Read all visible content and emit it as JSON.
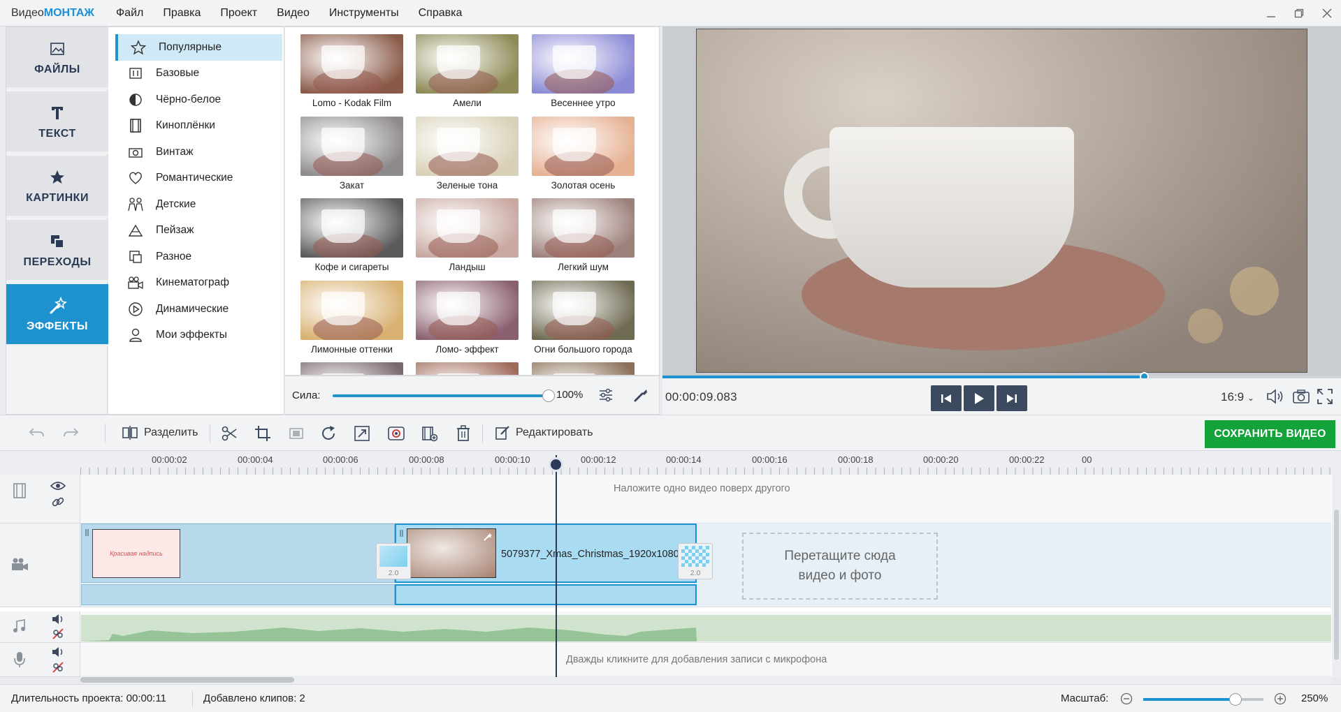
{
  "app": {
    "title_prefix": "Видео",
    "title_brand": "МОНТАЖ"
  },
  "menu": [
    "Файл",
    "Правка",
    "Проект",
    "Видео",
    "Инструменты",
    "Справка"
  ],
  "left_tabs": [
    {
      "label": "ФАЙЛЫ",
      "icon": "image-icon"
    },
    {
      "label": "ТЕКСТ",
      "icon": "text-icon"
    },
    {
      "label": "КАРТИНКИ",
      "icon": "star-icon"
    },
    {
      "label": "ПЕРЕХОДЫ",
      "icon": "transitions-icon"
    },
    {
      "label": "ЭФФЕКТЫ",
      "icon": "wand-icon",
      "active": true
    }
  ],
  "categories": [
    {
      "label": "Популярные",
      "icon": "star-outline-icon",
      "selected": true
    },
    {
      "label": "Базовые",
      "icon": "sliders-icon"
    },
    {
      "label": "Чёрно-белое",
      "icon": "half-circle-icon"
    },
    {
      "label": "Киноплёнки",
      "icon": "filmstrip-icon"
    },
    {
      "label": "Винтаж",
      "icon": "camera-icon"
    },
    {
      "label": "Романтические",
      "icon": "heart-icon"
    },
    {
      "label": "Детские",
      "icon": "kids-icon"
    },
    {
      "label": "Пейзаж",
      "icon": "mountain-icon"
    },
    {
      "label": "Разное",
      "icon": "misc-icon"
    },
    {
      "label": "Кинематограф",
      "icon": "movie-camera-icon"
    },
    {
      "label": "Динамические",
      "icon": "play-circle-icon"
    },
    {
      "label": "Мои эффекты",
      "icon": "user-icon"
    }
  ],
  "effects": [
    {
      "label": "Lomo - Kodak Film",
      "tint": "#8a5a48"
    },
    {
      "label": "Амели",
      "tint": "#8d8a55"
    },
    {
      "label": "Весеннее утро",
      "tint": "#8c8ad6"
    },
    {
      "label": "Закат",
      "tint": "#8e8a8c"
    },
    {
      "label": "Зеленые тона",
      "tint": "#d8d0b6"
    },
    {
      "label": "Золотая осень",
      "tint": "#e6b092"
    },
    {
      "label": "Кофе и сигареты",
      "tint": "#5a5a5a"
    },
    {
      "label": "Ландыш",
      "tint": "#c8a8a0"
    },
    {
      "label": "Легкий шум",
      "tint": "#9c807a"
    },
    {
      "label": "Лимонные оттенки",
      "tint": "#d8b070"
    },
    {
      "label": "Ломо- эффект",
      "tint": "#8a6070"
    },
    {
      "label": "Огни большого города",
      "tint": "#6f6a52"
    },
    {
      "label": "",
      "tint": "#7a6870"
    },
    {
      "label": "",
      "tint": "#a06a5a"
    },
    {
      "label": "",
      "tint": "#8a7058"
    }
  ],
  "strength": {
    "label": "Сила:",
    "value": "100%",
    "fraction": 1.0
  },
  "player": {
    "timecode": "00:00:09.083",
    "ratio": "16:9",
    "progress": 0.71
  },
  "toolbar": {
    "split": "Разделить",
    "edit": "Редактировать",
    "save": "СОХРАНИТЬ ВИДЕО"
  },
  "ruler": [
    "00:00:02",
    "00:00:04",
    "00:00:06",
    "00:00:08",
    "00:00:10",
    "00:00:12",
    "00:00:14",
    "00:00:16",
    "00:00:18",
    "00:00:20",
    "00:00:22",
    "00"
  ],
  "timeline": {
    "overlay_hint": "Наложите одно видео поверх другого",
    "clip_name": "5079377_Xmas_Christmas_1920x1080",
    "clip1_thumb_text": "Красивая надпись",
    "transition_value": "2.0",
    "dropzone_line1": "Перетащите сюда",
    "dropzone_line2": "видео и фото",
    "mic_hint": "Дважды кликните для добавления записи с микрофона"
  },
  "status": {
    "duration": "Длительность проекта:  00:00:11",
    "clips": "Добавлено клипов: 2",
    "zoom_label": "Масштаб:",
    "zoom_value": "250%",
    "zoom_fraction": 0.77
  },
  "colors": {
    "accent": "#1d92cf",
    "save": "#13a33a",
    "dark": "#3b4a5e"
  }
}
